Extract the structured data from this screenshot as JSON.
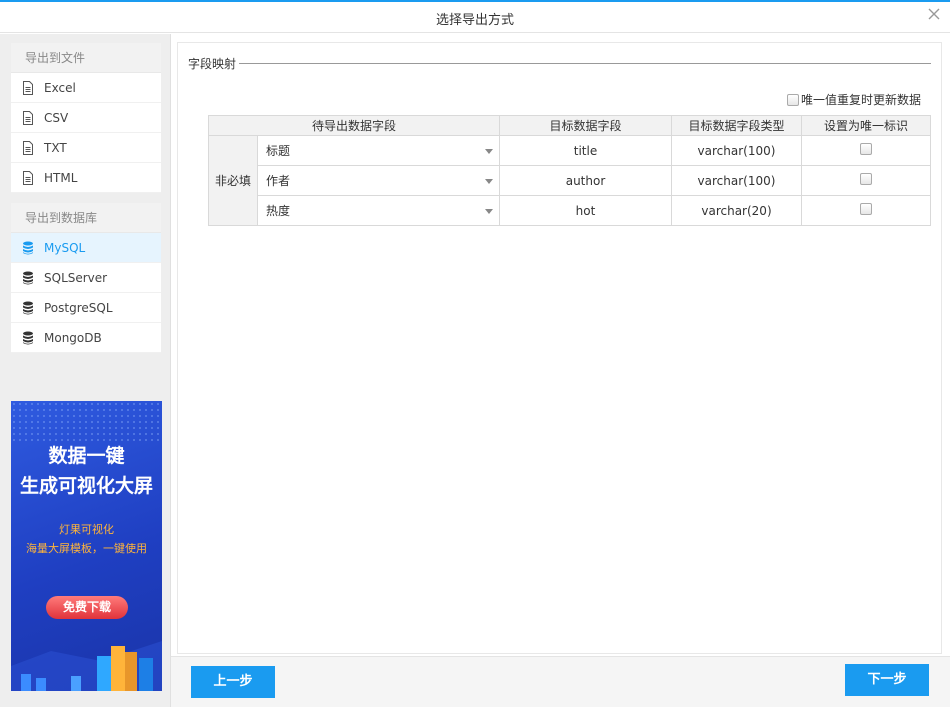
{
  "dialog": {
    "title": "选择导出方式"
  },
  "sidebar": {
    "file_group": {
      "header": "导出到文件",
      "items": [
        {
          "label": "Excel",
          "icon": "file-icon"
        },
        {
          "label": "CSV",
          "icon": "file-icon"
        },
        {
          "label": "TXT",
          "icon": "file-icon"
        },
        {
          "label": "HTML",
          "icon": "file-icon"
        }
      ]
    },
    "db_group": {
      "header": "导出到数据库",
      "items": [
        {
          "label": "MySQL",
          "icon": "database-icon",
          "active": true
        },
        {
          "label": "SQLServer",
          "icon": "database-icon"
        },
        {
          "label": "PostgreSQL",
          "icon": "database-icon"
        },
        {
          "label": "MongoDB",
          "icon": "database-icon"
        }
      ]
    },
    "banner": {
      "line1": "数据一键",
      "line2": "生成可视化大屏",
      "sub1": "灯果可视化",
      "sub2": "海量大屏模板，一键使用",
      "button": "免费下载"
    }
  },
  "main": {
    "section_title": "字段映射",
    "unique_option_label": "唯一值重复时更新数据",
    "table": {
      "headers": [
        "待导出数据字段",
        "目标数据字段",
        "目标数据字段类型",
        "设置为唯一标识"
      ],
      "group_label": "非必填",
      "rows": [
        {
          "source": "标题",
          "target": "title",
          "type": "varchar(100)"
        },
        {
          "source": "作者",
          "target": "author",
          "type": "varchar(100)"
        },
        {
          "source": "热度",
          "target": "hot",
          "type": "varchar(20)"
        }
      ]
    }
  },
  "footer": {
    "prev_label": "上一步",
    "next_label": "下一步"
  },
  "colors": {
    "accent": "#1a9bf0",
    "active_bg": "#e6f4fe",
    "sidebar_bg": "#eeeeee"
  }
}
